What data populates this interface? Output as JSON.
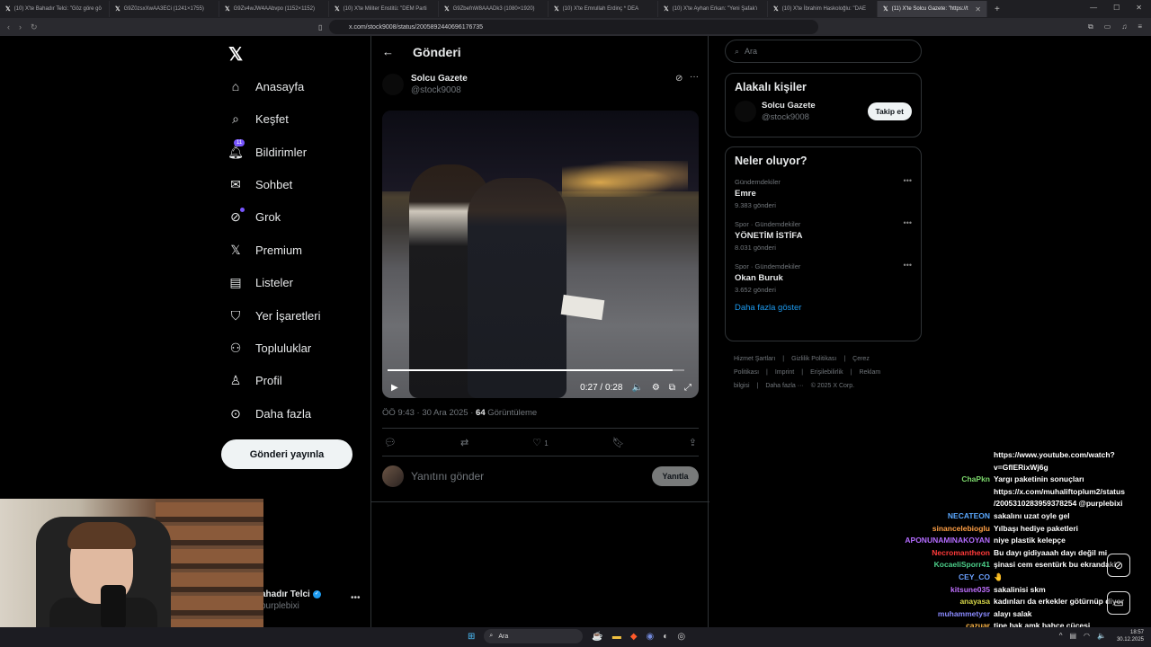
{
  "browser": {
    "tabs": [
      {
        "label": "(10) X'te Bahadır Telci: \"Göz göre gö"
      },
      {
        "label": "G9Z0zsxXwAA3ECi (1241×1755)"
      },
      {
        "label": "G9Zv4wJW4AAbvpo (1152×1152)"
      },
      {
        "label": "(10) X'te Militer Enstitü: \"DEM Parti"
      },
      {
        "label": "G9ZbefnW8AAADk3 (1080×1920)"
      },
      {
        "label": "(10) X'te Emrullah Erdinç * DEA"
      },
      {
        "label": "(10) X'te Ayhan Erkan: \"Yeni Şafak'ı"
      },
      {
        "label": "(10) X'te İbrahim Haskoloğlu: \"DAE"
      },
      {
        "label": "(11) X'te Solcu Gazete: \"https://t"
      }
    ],
    "url": "x.com/stock9008/status/2005892440696176735"
  },
  "nav": {
    "logo": "𝕏",
    "items": [
      {
        "label": "Anasayfa",
        "icon": "home-icon"
      },
      {
        "label": "Keşfet",
        "icon": "search-icon"
      },
      {
        "label": "Bildirimler",
        "icon": "bell-icon",
        "badge": "11"
      },
      {
        "label": "Sohbet",
        "icon": "mail-icon"
      },
      {
        "label": "Grok",
        "icon": "grok-icon"
      },
      {
        "label": "Premium",
        "icon": "x-icon"
      },
      {
        "label": "Listeler",
        "icon": "list-icon"
      },
      {
        "label": "Yer İşaretleri",
        "icon": "bookmark-icon"
      },
      {
        "label": "Topluluklar",
        "icon": "communities-icon"
      },
      {
        "label": "Profil",
        "icon": "profile-icon"
      },
      {
        "label": "Daha fazla",
        "icon": "more-icon"
      }
    ],
    "post_button": "Gönderi yayınla",
    "account": {
      "name": "ahadır Telci",
      "handle": "purplebixi"
    }
  },
  "post": {
    "header_title": "Gönderi",
    "author_name": "Solcu Gazete",
    "author_handle": "@stock9008",
    "video": {
      "time": "0:27 / 0:28",
      "progress": 0.96
    },
    "meta_time": "ÖÖ 9:43 · 30 Ara 2025 · ",
    "views_count": "64",
    "views_label": " Görüntüleme",
    "likes": "1",
    "reply_placeholder": "Yanıtını gönder",
    "reply_button": "Yanıtla"
  },
  "right": {
    "search_placeholder": "Ara",
    "related_title": "Alakalı kişiler",
    "related": {
      "name": "Solcu Gazete",
      "handle": "@stock9008",
      "follow": "Takip et"
    },
    "trends_title": "Neler oluyor?",
    "trends": [
      {
        "category": "Gündemdekiler",
        "name": "Emre",
        "posts": "9.383 gönderi"
      },
      {
        "category": "Spor · Gündemdekiler",
        "name": "YÖNETİM İSTİFA",
        "posts": "8.031 gönderi"
      },
      {
        "category": "Spor · Gündemdekiler",
        "name": "Okan Buruk",
        "posts": "3.652 gönderi"
      }
    ],
    "show_more": "Daha fazla göster",
    "footer": [
      "Hizmet Şartları",
      "Gizlilik Politikası",
      "Çerez Politikası",
      "Imprint",
      "Erişilebilirlik",
      "Reklam bilgisi",
      "Daha fazla ···",
      "© 2025 X Corp."
    ]
  },
  "chat": [
    {
      "user": "",
      "color": "#ffffff",
      "msg": "https://www.youtube.com/watch?"
    },
    {
      "user": "",
      "color": "#ffffff",
      "msg": "v=GfIERixWj6g"
    },
    {
      "user": "ChaPkn",
      "color": "#7cd86c",
      "msg": "Yargı paketinin sonuçları"
    },
    {
      "user": "",
      "color": "#ffffff",
      "msg": "https://x.com/muhaliftoplum2/status"
    },
    {
      "user": "",
      "color": "#ffffff",
      "msg": "/2005310283959378254 @purplebixi"
    },
    {
      "user": "NECATEON",
      "color": "#5aa8ff",
      "msg": "sakalını uzat oyle gel"
    },
    {
      "user": "sinancelebioglu",
      "color": "#ff9f45",
      "msg": "Yılbaşı hediye paketleri"
    },
    {
      "user": "APONUNAMINAKOYAN",
      "color": "#b46cff",
      "msg": "niye plastik kelepçe"
    },
    {
      "user": "Necromantheon",
      "color": "#ff3a3a",
      "msg": "Bu dayı gidiyaaah dayı değil mi"
    },
    {
      "user": "KocaeliSporr41",
      "color": "#4cd08a",
      "msg": "şinasi cem esentürk bu ekrandaki"
    },
    {
      "user": "CEY_CO",
      "color": "#6aa0ff",
      "msg": "🤚"
    },
    {
      "user": "kitsune035",
      "color": "#c070ff",
      "msg": "sakalinisi skm"
    },
    {
      "user": "anayasa",
      "color": "#d8d84a",
      "msg": "kadınları da erkekler götürnüp diyor"
    },
    {
      "user": "muhammetysr",
      "color": "#8a8aff",
      "msg": "alayı salak"
    },
    {
      "user": "cazuar",
      "color": "#ffb84a",
      "msg": "tipe bak amk bahçe cücesi"
    },
    {
      "user": "",
      "color": "#ffffff",
      "msg": "@purplebixi"
    }
  ],
  "taskbar": {
    "search": "Ara",
    "time": "18:57",
    "date": "30.12.2025"
  }
}
